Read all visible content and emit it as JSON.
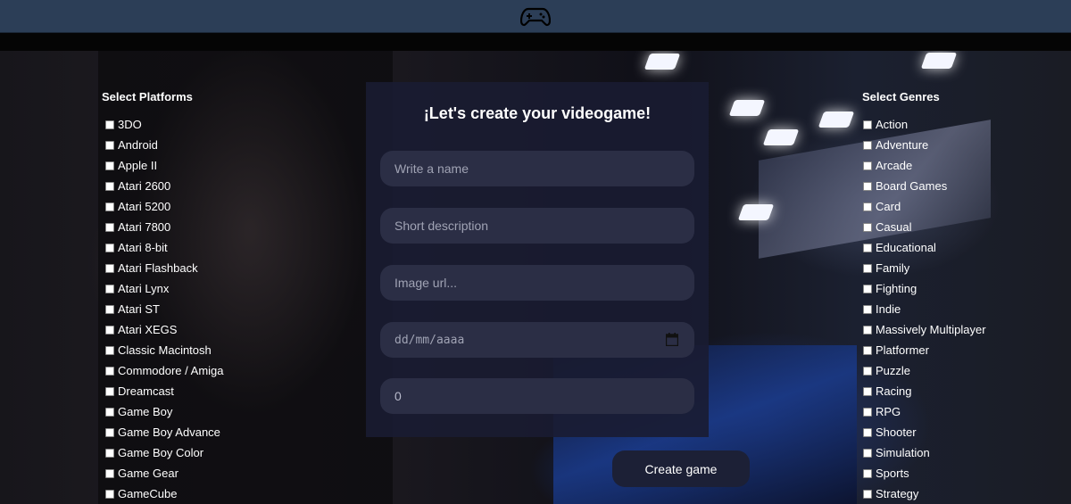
{
  "header": {
    "logo_icon": "gamepad-icon"
  },
  "platforms": {
    "title": "Select Platforms",
    "items": [
      "3DO",
      "Android",
      "Apple II",
      "Atari 2600",
      "Atari 5200",
      "Atari 7800",
      "Atari 8-bit",
      "Atari Flashback",
      "Atari Lynx",
      "Atari ST",
      "Atari XEGS",
      "Classic Macintosh",
      "Commodore / Amiga",
      "Dreamcast",
      "Game Boy",
      "Game Boy Advance",
      "Game Boy Color",
      "Game Gear",
      "GameCube"
    ]
  },
  "genres": {
    "title": "Select Genres",
    "items": [
      "Action",
      "Adventure",
      "Arcade",
      "Board Games",
      "Card",
      "Casual",
      "Educational",
      "Family",
      "Fighting",
      "Indie",
      "Massively Multiplayer",
      "Platformer",
      "Puzzle",
      "Racing",
      "RPG",
      "Shooter",
      "Simulation",
      "Sports",
      "Strategy"
    ]
  },
  "form": {
    "title": "¡Let's create your videogame!",
    "name_placeholder": "Write a name",
    "description_placeholder": "Short description",
    "image_placeholder": "Image url...",
    "date_placeholder": "dd/mm/aaaa",
    "rating_value": "0",
    "submit_label": "Create game"
  },
  "colors": {
    "topbar": "#2c3e57",
    "panel": "#1a1c32",
    "field": "#2b2e45",
    "button": "#1c2036"
  }
}
